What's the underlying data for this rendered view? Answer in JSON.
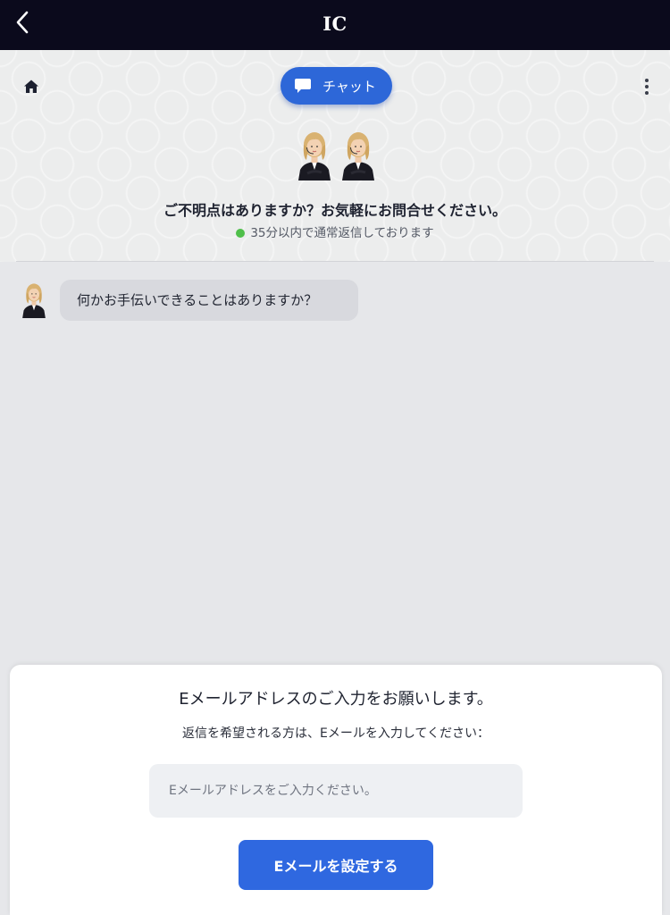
{
  "header": {
    "title": "IC"
  },
  "hero": {
    "tab_label": "チャット",
    "title": "ご不明点はありますか？お気軽にお問合せください。",
    "status_text": "35分以内で通常返信しております",
    "status_color": "#4fbf4a"
  },
  "messages": [
    {
      "text": "何かお手伝いできることはありますか？"
    }
  ],
  "email_form": {
    "title": "Eメールアドレスのご入力をお願いします。",
    "subtitle": "返信を希望される方は、Eメールを入力してください：",
    "placeholder": "Eメールアドレスをご入力ください。",
    "value": "",
    "button_label": "Eメールを設定する"
  },
  "colors": {
    "accent": "#2d67d8",
    "header_bg": "#0b0a1c",
    "bubble_bg": "#d8d9de"
  },
  "icons": [
    "chevron-left-icon",
    "home-icon",
    "chat-bubble-icon",
    "more-vertical-icon"
  ]
}
